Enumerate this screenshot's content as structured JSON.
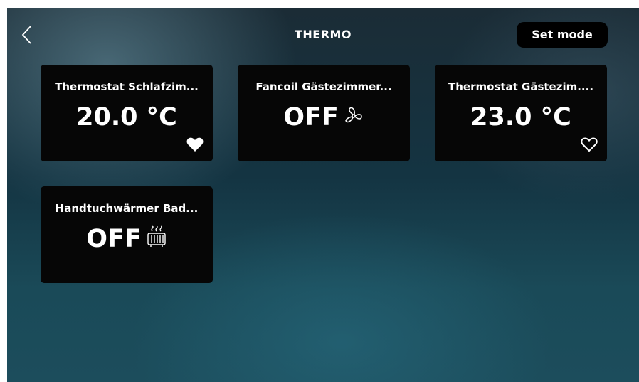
{
  "header": {
    "title": "THERMO",
    "mode_button_label": "Set mode",
    "back_icon": "chevron-left-icon"
  },
  "tiles": [
    {
      "name": "Thermostat Schlafzim...",
      "value": "20.0 °C",
      "favorite": true,
      "icon": "heart-filled-icon"
    },
    {
      "name": "Fancoil Gästezimmer...",
      "value": "OFF",
      "icon": "fan-icon"
    },
    {
      "name": "Thermostat Gästezim....",
      "value": "23.0 °C",
      "favorite": false,
      "icon": "heart-outline-icon"
    },
    {
      "name": "Handtuchwärmer Bad...",
      "value": "OFF",
      "icon": "radiator-icon"
    }
  ],
  "colors": {
    "tile_background": "#060606",
    "text": "#ffffff",
    "background_top": "#1b2c36",
    "background_bottom": "#1c4d5c"
  }
}
